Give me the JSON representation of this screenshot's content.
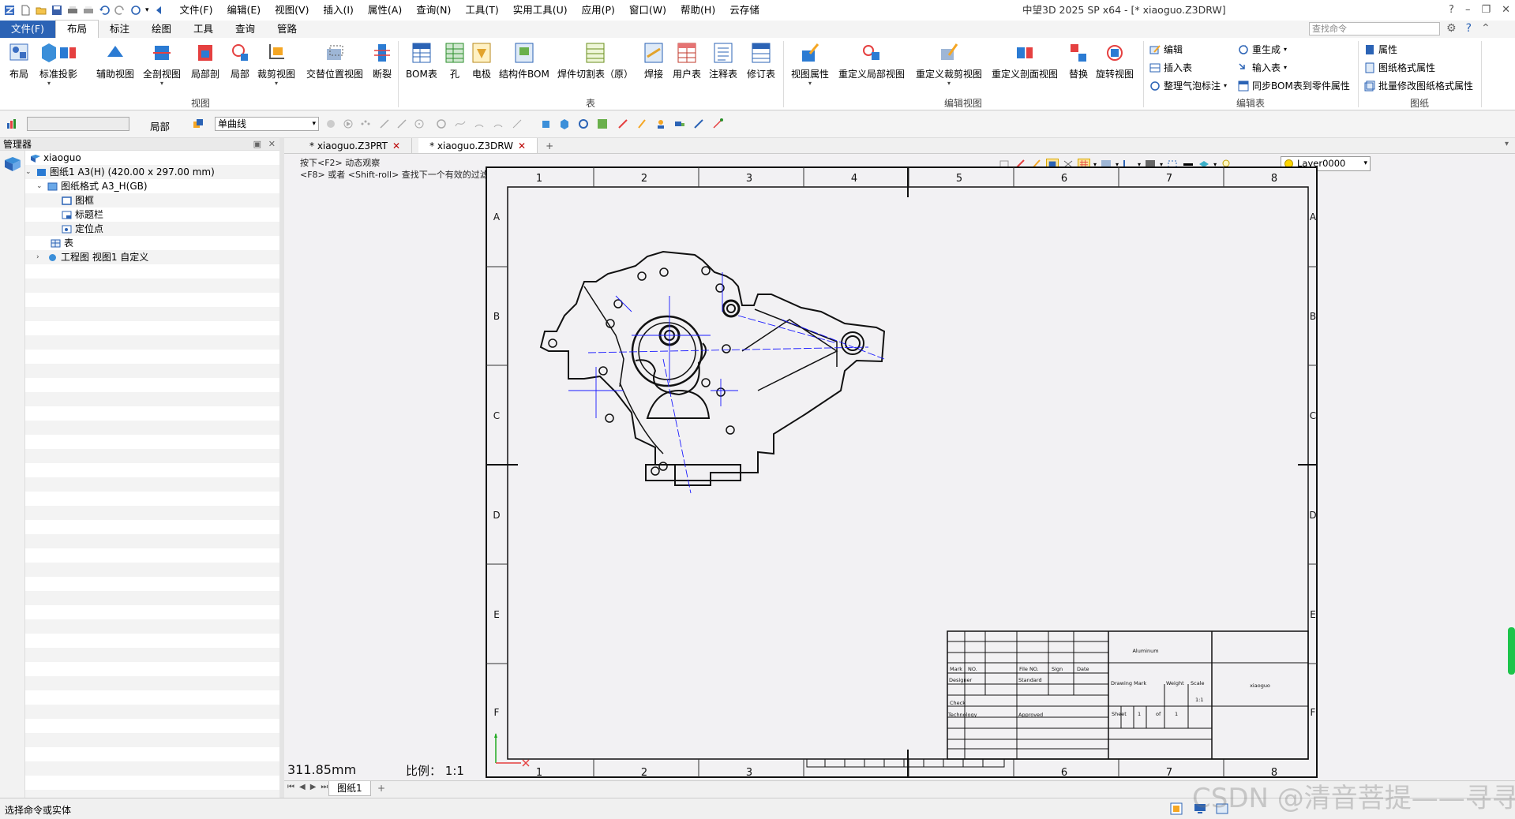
{
  "titlebar": {
    "menus": [
      "文件(F)",
      "编辑(E)",
      "视图(V)",
      "插入(I)",
      "属性(A)",
      "查询(N)",
      "工具(T)",
      "实用工具(U)",
      "应用(P)",
      "窗口(W)",
      "帮助(H)",
      "云存储"
    ],
    "title": "中望3D 2025 SP x64 - [* xiaoguo.Z3DRW]"
  },
  "ribbon_tabs": [
    "文件(F)",
    "布局",
    "标注",
    "绘图",
    "工具",
    "查询",
    "管路"
  ],
  "search": {
    "placeholder": "查找命令"
  },
  "ribbon": {
    "view_buttons": [
      "布局",
      "标准",
      "投影",
      "辅助视图",
      "全剖视图",
      "局部剖",
      "局部",
      "裁剪视图",
      "交替位置视图",
      "断裂"
    ],
    "view_group": "视图",
    "table_buttons": [
      "BOM表",
      "孔",
      "电极",
      "结构件BOM",
      "焊件切割表（原）",
      "焊接",
      "用户表",
      "注释表",
      "修订表"
    ],
    "table_group": "表",
    "edit_view_buttons": [
      "视图属性",
      "重定义局部视图",
      "重定义裁剪视图",
      "重定义剖面视图",
      "替换",
      "旋转视图"
    ],
    "edit_view_group": "编辑视图",
    "edit_table_items": [
      "编辑",
      "插入表",
      "整理气泡标注",
      "重生成",
      "输入表",
      "同步BOM表到零件属性"
    ],
    "edit_table_group": "编辑表",
    "sheet_items": [
      "属性",
      "图纸格式属性",
      "批量修改图纸格式属性"
    ],
    "sheet_group": "图纸"
  },
  "toolbar2": {
    "filter_label": "局部",
    "curve_type": "单曲线"
  },
  "manager": {
    "title": "管理器",
    "tree": [
      {
        "label": "xiaoguo"
      },
      {
        "label": "图纸1 A3(H) (420.00 x 297.00 mm)"
      },
      {
        "label": "图纸格式 A3_H(GB)"
      },
      {
        "label": "图框"
      },
      {
        "label": "标题栏"
      },
      {
        "label": "定位点"
      },
      {
        "label": "表"
      },
      {
        "label": "工程图 视图1 自定义"
      }
    ]
  },
  "doc_tabs": [
    "* xiaoguo.Z3PRT",
    "* xiaoguo.Z3DRW"
  ],
  "canvas": {
    "hint1": "按下<F2> 动态观察",
    "hint2": "<F8> 或者 <Shift-roll> 查找下一个有效的过滤器设置",
    "layer": "Layer0000",
    "distance": "311.85mm",
    "scale_label": "比例：",
    "scale_value": "1:1"
  },
  "drawing": {
    "col_numbers": [
      "1",
      "2",
      "3",
      "4",
      "5",
      "6",
      "7",
      "8"
    ],
    "row_letters": [
      "A",
      "B",
      "C",
      "D",
      "E",
      "F"
    ],
    "title_block": {
      "material": "Aluminum",
      "name": "xiaoguo",
      "mark": "Mark",
      "no": "NO.",
      "file_no": "File NO.",
      "sign": "Sign",
      "date": "Date",
      "designer": "Designer",
      "standard": "Standard",
      "check": "Check",
      "technology": "Technology",
      "approved": "Approved",
      "drawing_mark": "Drawing Mark",
      "weight": "Weight",
      "scale": "Scale",
      "scale_val": "1:1",
      "sheet": "Sheet",
      "sheet_num": "1",
      "of": "of",
      "sheet_total": "1"
    }
  },
  "sheet_tabs": {
    "current": "图纸1"
  },
  "statusbar": {
    "message": "选择命令或实体"
  },
  "watermark": "CSDN @清音菩提——寻寻"
}
